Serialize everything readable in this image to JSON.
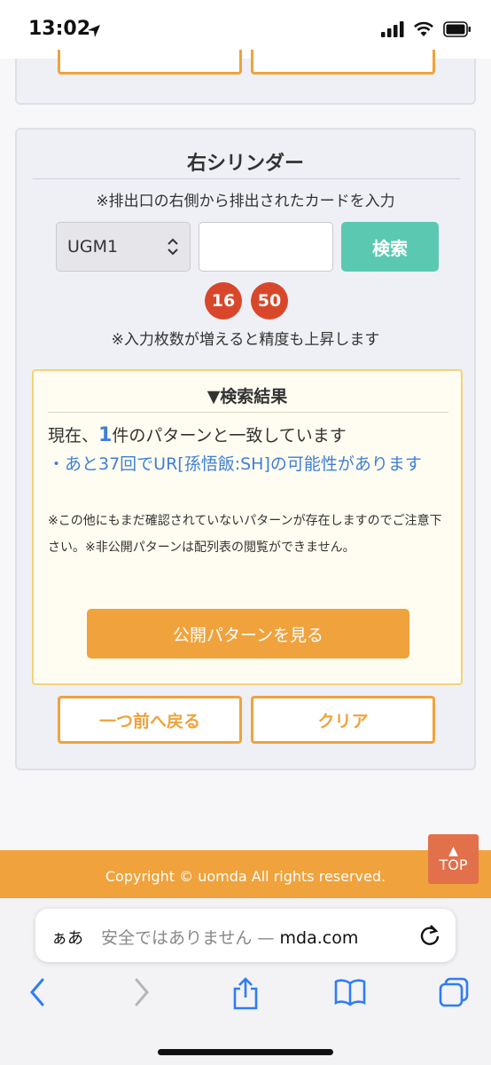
{
  "status_bar": {
    "time": "13:02",
    "icons": [
      "location-icon",
      "signal-icon",
      "wifi-icon",
      "battery-icon"
    ]
  },
  "section": {
    "title": "右シリンダー",
    "subtitle": "※排出口の右側から排出されたカードを入力",
    "select_value": "UGM1",
    "input_value": "",
    "search_label": "検索",
    "badges": [
      "16",
      "50"
    ],
    "note": "※入力枚数が増えると精度も上昇します"
  },
  "results": {
    "title": "▼検索結果",
    "prefix": "現在、",
    "count": "1",
    "suffix": "件のパターンと一致しています",
    "link": "・あと37回でUR[孫悟飯:SH]の可能性があります",
    "notice": "※この他にもまだ確認されていないパターンが存在しますのでご注意下さい。※非公開パターンは配列表の閲覧ができません。",
    "view_button": "公開パターンを見る"
  },
  "buttons": {
    "back": "一つ前へ戻る",
    "clear": "クリア"
  },
  "footer": {
    "copyright": "Copyright © uomda All rights reserved.",
    "top_label": "TOP",
    "top_arrow": "▲"
  },
  "browser": {
    "aa": "ぁあ",
    "url_prefix": "安全ではありません — ",
    "url_domain": "mda.com"
  },
  "colors": {
    "accent": "#f0a23c",
    "teal": "#5bc9b2",
    "badge": "#d9472b",
    "link": "#3f7fd6",
    "ios_blue": "#2f7cf6"
  }
}
